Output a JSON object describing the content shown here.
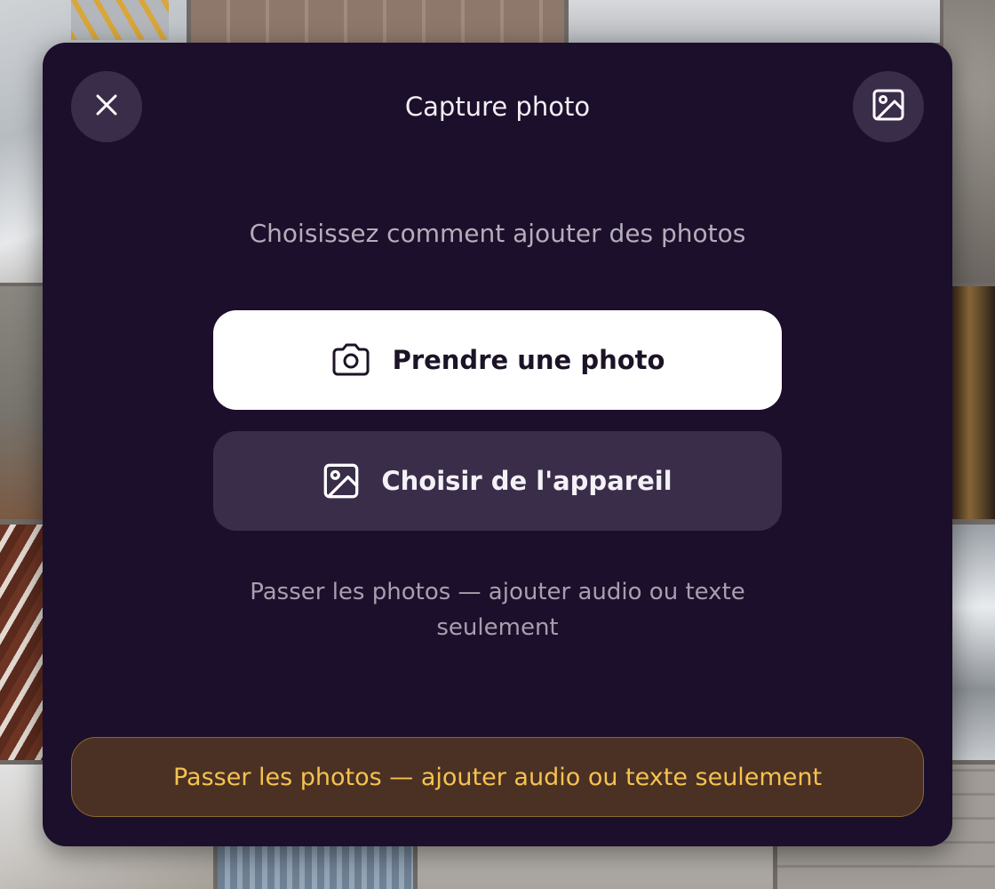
{
  "header": {
    "title": "Capture photo"
  },
  "subtitle": "Choisissez comment ajouter des photos",
  "actions": {
    "take_photo": "Prendre une photo",
    "choose_device": "Choisir de l'appareil"
  },
  "skip_link": "Passer les photos — ajouter audio ou texte seulement",
  "skip_bar": "Passer les photos — ajouter audio ou texte seulement",
  "icons": {
    "close": "close-icon",
    "gallery": "image-icon",
    "camera": "camera-icon",
    "device_image": "image-icon"
  },
  "colors": {
    "modal_bg": "#1c0f2b",
    "secondary_btn": "#3a2d4a",
    "primary_btn": "#ffffff",
    "skip_bar_bg": "#4b3024",
    "skip_bar_text": "#f4c34f",
    "skip_bar_border": "#8a6a2b"
  }
}
